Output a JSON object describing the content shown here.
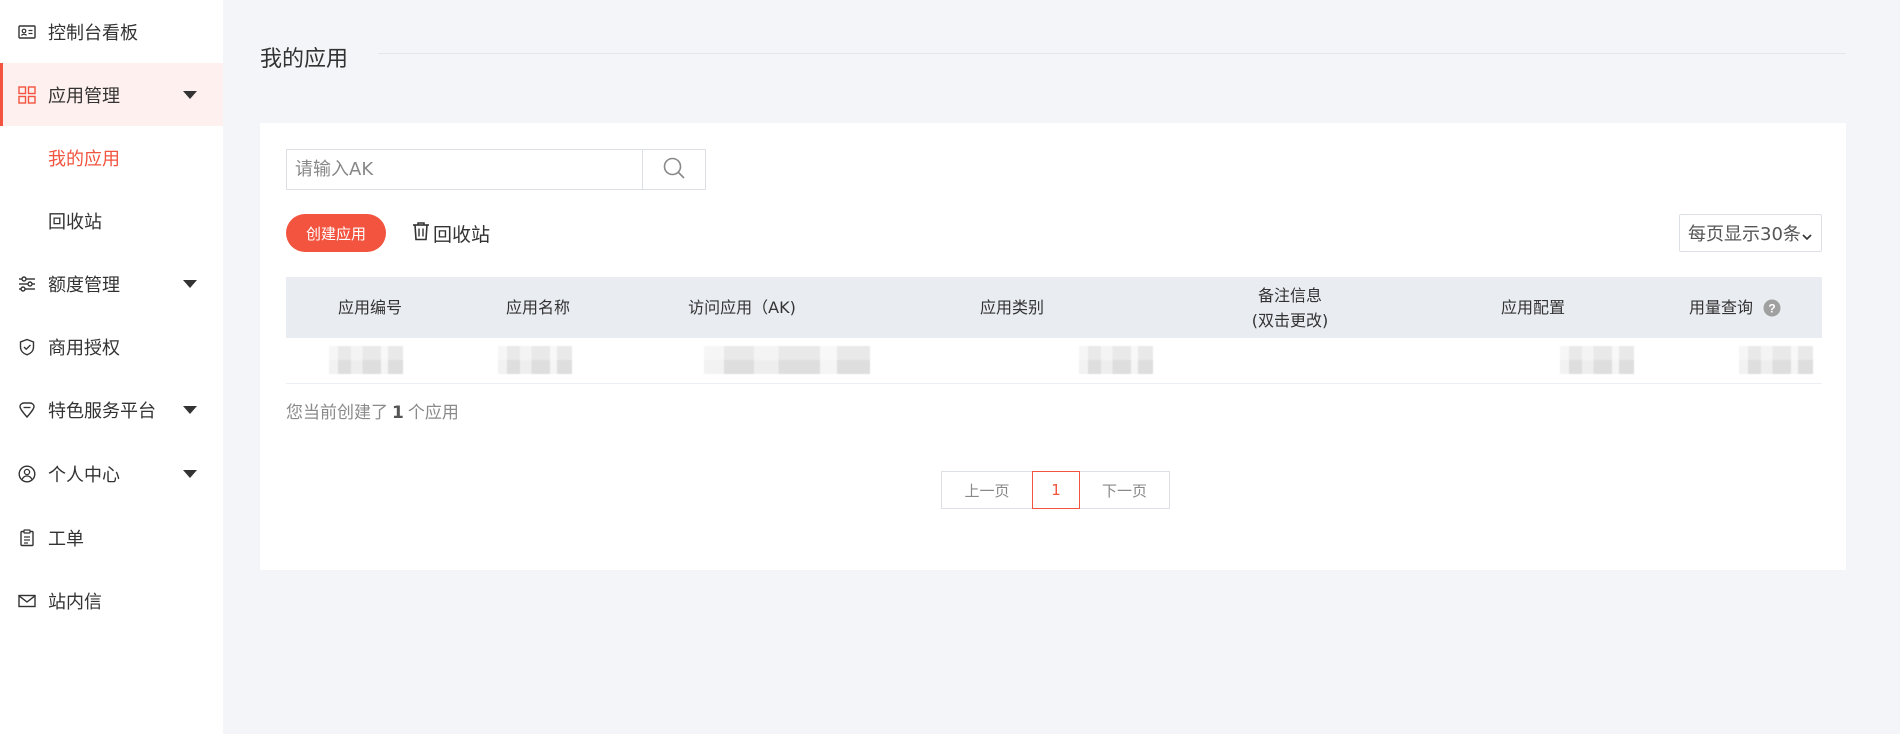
{
  "sidebar": {
    "items": [
      {
        "label": "控制台看板",
        "icon": "id-card-icon"
      },
      {
        "label": "应用管理",
        "icon": "grid-icon",
        "expanded": true
      },
      {
        "label": "额度管理",
        "icon": "sliders-icon"
      },
      {
        "label": "商用授权",
        "icon": "shield-check-icon"
      },
      {
        "label": "特色服务平台",
        "icon": "diamond-icon"
      },
      {
        "label": "个人中心",
        "icon": "user-circle-icon"
      },
      {
        "label": "工单",
        "icon": "clipboard-icon"
      },
      {
        "label": "站内信",
        "icon": "mail-icon"
      }
    ],
    "sub_items": [
      {
        "label": "我的应用",
        "selected": true
      },
      {
        "label": "回收站"
      }
    ]
  },
  "main": {
    "title": "我的应用",
    "search": {
      "placeholder": "请输入AK",
      "value": ""
    },
    "create_label": "创建应用",
    "recycle_label": "回收站",
    "page_size_label": "每页显示30条",
    "table": {
      "columns": [
        "应用编号",
        "应用名称",
        "访问应用（AK)",
        "应用类别",
        "备注信息\n(双击更改)",
        "应用配置",
        "用量查询"
      ]
    },
    "summary": {
      "prefix": "您当前创建了",
      "count": "1",
      "suffix": "个应用"
    },
    "pagination": {
      "prev": "上一页",
      "current": "1",
      "next": "下一页"
    }
  },
  "colors": {
    "accent": "#f2543f",
    "active_bg": "#fef0ee",
    "page_bg": "#f4f5f8",
    "table_head_bg": "#e9ecf1"
  }
}
